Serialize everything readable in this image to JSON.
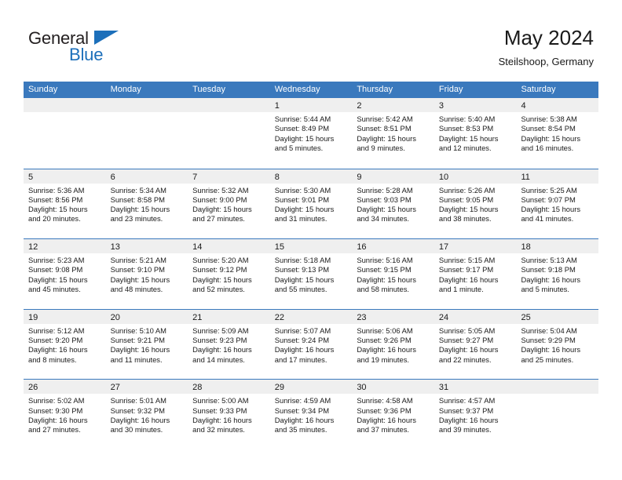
{
  "brand": {
    "name_top": "General",
    "name_bottom": "Blue",
    "color_dark": "#231f20",
    "color_blue": "#1c6fba"
  },
  "header": {
    "title": "May 2024",
    "subtitle": "Steilshoop, Germany"
  },
  "theme": {
    "header_bar": "#3a79bd",
    "daynum_band": "#efefef",
    "text": "#1a1a1a"
  },
  "weekdays": [
    "Sunday",
    "Monday",
    "Tuesday",
    "Wednesday",
    "Thursday",
    "Friday",
    "Saturday"
  ],
  "weeks": [
    [
      {
        "day": "",
        "sunrise": "",
        "sunset": "",
        "daylight": ""
      },
      {
        "day": "",
        "sunrise": "",
        "sunset": "",
        "daylight": ""
      },
      {
        "day": "",
        "sunrise": "",
        "sunset": "",
        "daylight": ""
      },
      {
        "day": "1",
        "sunrise": "Sunrise: 5:44 AM",
        "sunset": "Sunset: 8:49 PM",
        "daylight": "Daylight: 15 hours and 5 minutes."
      },
      {
        "day": "2",
        "sunrise": "Sunrise: 5:42 AM",
        "sunset": "Sunset: 8:51 PM",
        "daylight": "Daylight: 15 hours and 9 minutes."
      },
      {
        "day": "3",
        "sunrise": "Sunrise: 5:40 AM",
        "sunset": "Sunset: 8:53 PM",
        "daylight": "Daylight: 15 hours and 12 minutes."
      },
      {
        "day": "4",
        "sunrise": "Sunrise: 5:38 AM",
        "sunset": "Sunset: 8:54 PM",
        "daylight": "Daylight: 15 hours and 16 minutes."
      }
    ],
    [
      {
        "day": "5",
        "sunrise": "Sunrise: 5:36 AM",
        "sunset": "Sunset: 8:56 PM",
        "daylight": "Daylight: 15 hours and 20 minutes."
      },
      {
        "day": "6",
        "sunrise": "Sunrise: 5:34 AM",
        "sunset": "Sunset: 8:58 PM",
        "daylight": "Daylight: 15 hours and 23 minutes."
      },
      {
        "day": "7",
        "sunrise": "Sunrise: 5:32 AM",
        "sunset": "Sunset: 9:00 PM",
        "daylight": "Daylight: 15 hours and 27 minutes."
      },
      {
        "day": "8",
        "sunrise": "Sunrise: 5:30 AM",
        "sunset": "Sunset: 9:01 PM",
        "daylight": "Daylight: 15 hours and 31 minutes."
      },
      {
        "day": "9",
        "sunrise": "Sunrise: 5:28 AM",
        "sunset": "Sunset: 9:03 PM",
        "daylight": "Daylight: 15 hours and 34 minutes."
      },
      {
        "day": "10",
        "sunrise": "Sunrise: 5:26 AM",
        "sunset": "Sunset: 9:05 PM",
        "daylight": "Daylight: 15 hours and 38 minutes."
      },
      {
        "day": "11",
        "sunrise": "Sunrise: 5:25 AM",
        "sunset": "Sunset: 9:07 PM",
        "daylight": "Daylight: 15 hours and 41 minutes."
      }
    ],
    [
      {
        "day": "12",
        "sunrise": "Sunrise: 5:23 AM",
        "sunset": "Sunset: 9:08 PM",
        "daylight": "Daylight: 15 hours and 45 minutes."
      },
      {
        "day": "13",
        "sunrise": "Sunrise: 5:21 AM",
        "sunset": "Sunset: 9:10 PM",
        "daylight": "Daylight: 15 hours and 48 minutes."
      },
      {
        "day": "14",
        "sunrise": "Sunrise: 5:20 AM",
        "sunset": "Sunset: 9:12 PM",
        "daylight": "Daylight: 15 hours and 52 minutes."
      },
      {
        "day": "15",
        "sunrise": "Sunrise: 5:18 AM",
        "sunset": "Sunset: 9:13 PM",
        "daylight": "Daylight: 15 hours and 55 minutes."
      },
      {
        "day": "16",
        "sunrise": "Sunrise: 5:16 AM",
        "sunset": "Sunset: 9:15 PM",
        "daylight": "Daylight: 15 hours and 58 minutes."
      },
      {
        "day": "17",
        "sunrise": "Sunrise: 5:15 AM",
        "sunset": "Sunset: 9:17 PM",
        "daylight": "Daylight: 16 hours and 1 minute."
      },
      {
        "day": "18",
        "sunrise": "Sunrise: 5:13 AM",
        "sunset": "Sunset: 9:18 PM",
        "daylight": "Daylight: 16 hours and 5 minutes."
      }
    ],
    [
      {
        "day": "19",
        "sunrise": "Sunrise: 5:12 AM",
        "sunset": "Sunset: 9:20 PM",
        "daylight": "Daylight: 16 hours and 8 minutes."
      },
      {
        "day": "20",
        "sunrise": "Sunrise: 5:10 AM",
        "sunset": "Sunset: 9:21 PM",
        "daylight": "Daylight: 16 hours and 11 minutes."
      },
      {
        "day": "21",
        "sunrise": "Sunrise: 5:09 AM",
        "sunset": "Sunset: 9:23 PM",
        "daylight": "Daylight: 16 hours and 14 minutes."
      },
      {
        "day": "22",
        "sunrise": "Sunrise: 5:07 AM",
        "sunset": "Sunset: 9:24 PM",
        "daylight": "Daylight: 16 hours and 17 minutes."
      },
      {
        "day": "23",
        "sunrise": "Sunrise: 5:06 AM",
        "sunset": "Sunset: 9:26 PM",
        "daylight": "Daylight: 16 hours and 19 minutes."
      },
      {
        "day": "24",
        "sunrise": "Sunrise: 5:05 AM",
        "sunset": "Sunset: 9:27 PM",
        "daylight": "Daylight: 16 hours and 22 minutes."
      },
      {
        "day": "25",
        "sunrise": "Sunrise: 5:04 AM",
        "sunset": "Sunset: 9:29 PM",
        "daylight": "Daylight: 16 hours and 25 minutes."
      }
    ],
    [
      {
        "day": "26",
        "sunrise": "Sunrise: 5:02 AM",
        "sunset": "Sunset: 9:30 PM",
        "daylight": "Daylight: 16 hours and 27 minutes."
      },
      {
        "day": "27",
        "sunrise": "Sunrise: 5:01 AM",
        "sunset": "Sunset: 9:32 PM",
        "daylight": "Daylight: 16 hours and 30 minutes."
      },
      {
        "day": "28",
        "sunrise": "Sunrise: 5:00 AM",
        "sunset": "Sunset: 9:33 PM",
        "daylight": "Daylight: 16 hours and 32 minutes."
      },
      {
        "day": "29",
        "sunrise": "Sunrise: 4:59 AM",
        "sunset": "Sunset: 9:34 PM",
        "daylight": "Daylight: 16 hours and 35 minutes."
      },
      {
        "day": "30",
        "sunrise": "Sunrise: 4:58 AM",
        "sunset": "Sunset: 9:36 PM",
        "daylight": "Daylight: 16 hours and 37 minutes."
      },
      {
        "day": "31",
        "sunrise": "Sunrise: 4:57 AM",
        "sunset": "Sunset: 9:37 PM",
        "daylight": "Daylight: 16 hours and 39 minutes."
      },
      {
        "day": "",
        "sunrise": "",
        "sunset": "",
        "daylight": ""
      }
    ]
  ]
}
